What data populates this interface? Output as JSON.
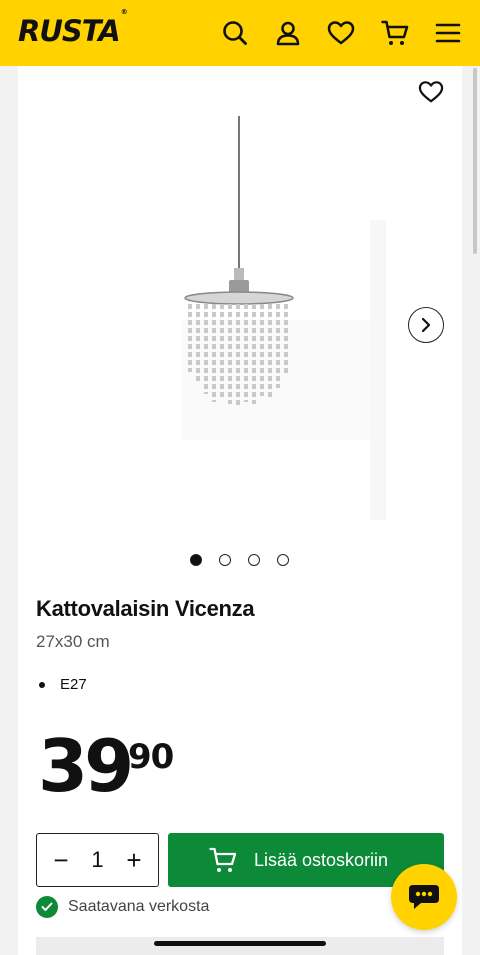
{
  "header": {
    "logo_text": "RUSTA",
    "logo_mark": "®",
    "icons": [
      "search-icon",
      "account-icon",
      "wishlist-icon",
      "cart-icon",
      "menu-icon"
    ],
    "background": "#ffd200"
  },
  "gallery": {
    "image_count": 4,
    "active_index": 0,
    "favorite_icon": "heart-outline-icon",
    "next_icon": "chevron-right-icon"
  },
  "product": {
    "title": "Kattovalaisin Vicenza",
    "subtitle": "27x30 cm",
    "features": [
      "E27"
    ],
    "price_integer": "39",
    "price_decimals": "90"
  },
  "purchase": {
    "quantity": "1",
    "minus_label": "−",
    "plus_label": "+",
    "add_to_cart_label": "Lisää ostoskoriin",
    "accent_color": "#0c8a38"
  },
  "availability": {
    "text": "Saatavana verkosta"
  },
  "chat": {
    "icon": "chat-bubble-icon"
  }
}
